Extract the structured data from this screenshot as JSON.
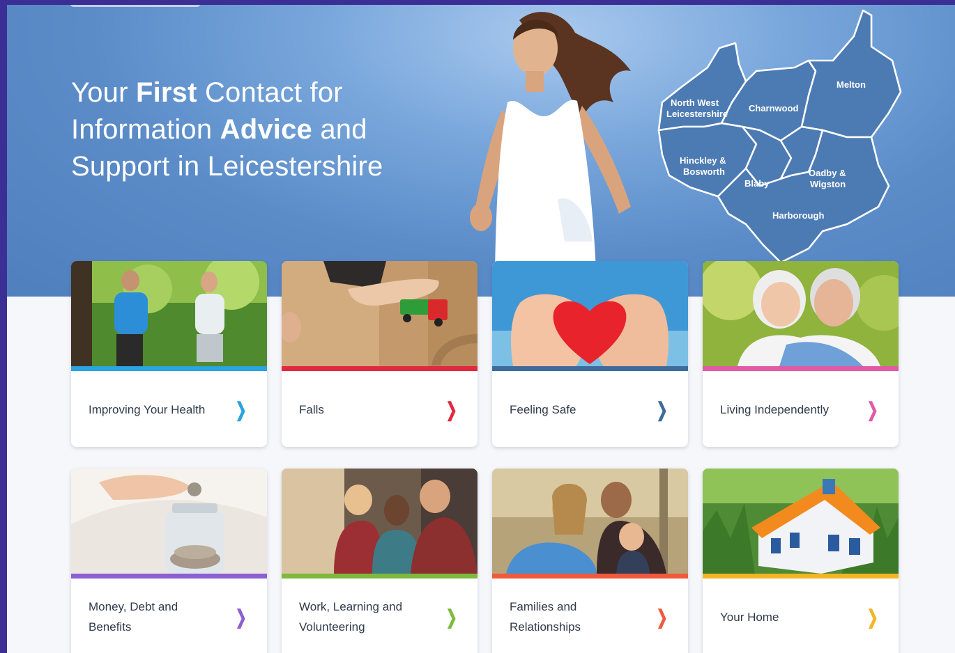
{
  "hero": {
    "headline_parts": [
      "Your ",
      "First",
      " Contact for",
      "Information ",
      "Advice",
      " and",
      "Support in Leicestershire"
    ]
  },
  "map": {
    "districts": [
      "North West",
      "Leicestershire",
      "Charnwood",
      "Melton",
      "Hinckley &",
      "Bosworth",
      "Blaby",
      "Oadby &",
      "Wigston",
      "Harborough"
    ]
  },
  "cards": [
    {
      "label": "Improving Your Health",
      "color": "#2aa3de",
      "chevron": "❯"
    },
    {
      "label": "Falls",
      "color": "#e2283f",
      "chevron": "❯"
    },
    {
      "label": "Feeling Safe",
      "color": "#3e6b9c",
      "chevron": "❯"
    },
    {
      "label": "Living Independently",
      "color": "#e05aa6",
      "chevron": "❯"
    },
    {
      "label_line1": "Money, Debt and",
      "label_line2": "Benefits",
      "color": "#8b5fd0",
      "chevron": "❯"
    },
    {
      "label_line1": "Work, Learning and",
      "label_line2": "Volunteering",
      "color": "#7dba3c",
      "chevron": "❯"
    },
    {
      "label_line1": "Families and",
      "label_line2": "Relationships",
      "color": "#f05a3c",
      "chevron": "❯"
    },
    {
      "label": "Your Home",
      "color": "#f2b523",
      "chevron": "❯"
    }
  ]
}
